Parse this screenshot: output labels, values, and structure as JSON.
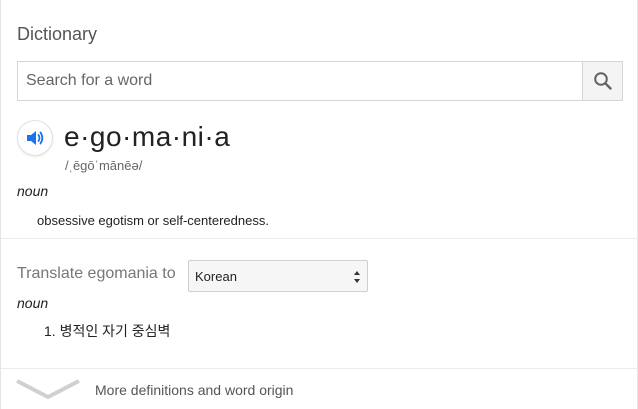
{
  "card": {
    "title": "Dictionary"
  },
  "search": {
    "placeholder": "Search for a word",
    "value": ""
  },
  "entry": {
    "headword": "e·go·ma·ni·a",
    "phonetic": "/ˌēgōˈmānēə/",
    "part_of_speech": "noun",
    "definition": "obsessive egotism or self-centeredness."
  },
  "translate": {
    "label": "Translate egomania to",
    "selected_language": "Korean",
    "part_of_speech": "noun",
    "items": [
      "1. 병적인 자기 중심벽"
    ]
  },
  "footer": {
    "more_label": "More definitions and word origin"
  },
  "colors": {
    "accent_blue": "#1a73e8",
    "icon_gray": "#5f6368",
    "chevron_gray": "#d0d0d0"
  },
  "icons": {
    "search": "search-icon",
    "speaker": "speaker-icon",
    "select_arrows": "select-arrows-icon",
    "more": "chevron-down-icon"
  }
}
